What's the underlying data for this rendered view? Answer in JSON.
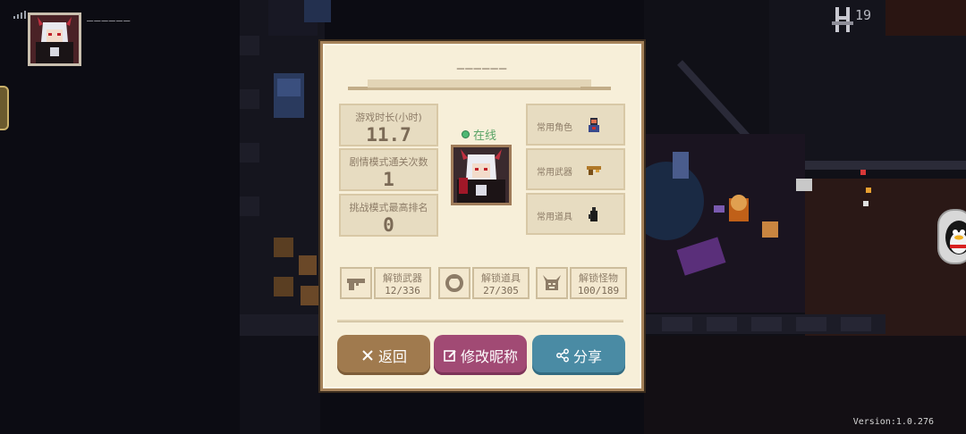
{
  "hud": {
    "player_name": "——————",
    "count": "19"
  },
  "dialog": {
    "title": "——————",
    "status": "在线",
    "stats": [
      {
        "label": "游戏时长(小时)",
        "value": "11.7"
      },
      {
        "label": "剧情模式通关次数",
        "value": "1"
      },
      {
        "label": "挑战模式最高排名",
        "value": "0"
      }
    ],
    "favorites": [
      {
        "label": "常用角色",
        "icon": "character-icon"
      },
      {
        "label": "常用武器",
        "icon": "gun-icon"
      },
      {
        "label": "常用道具",
        "icon": "bottle-icon"
      }
    ],
    "unlocks": [
      {
        "label": "解锁武器",
        "count": "12/336",
        "icon": "pistol-icon"
      },
      {
        "label": "解锁道具",
        "count": "27/305",
        "icon": "ring-icon"
      },
      {
        "label": "解锁怪物",
        "count": "100/189",
        "icon": "demon-icon"
      }
    ],
    "buttons": {
      "back": "返回",
      "edit_name": "修改昵称",
      "share": "分享"
    }
  },
  "version": "Version:1.0.276",
  "colors": {
    "dialog_bg": "#f7efd9",
    "back_button": "#a07a4e",
    "edit_button": "#a14a74",
    "share_button": "#4a8ba4",
    "online": "#4fb873"
  }
}
